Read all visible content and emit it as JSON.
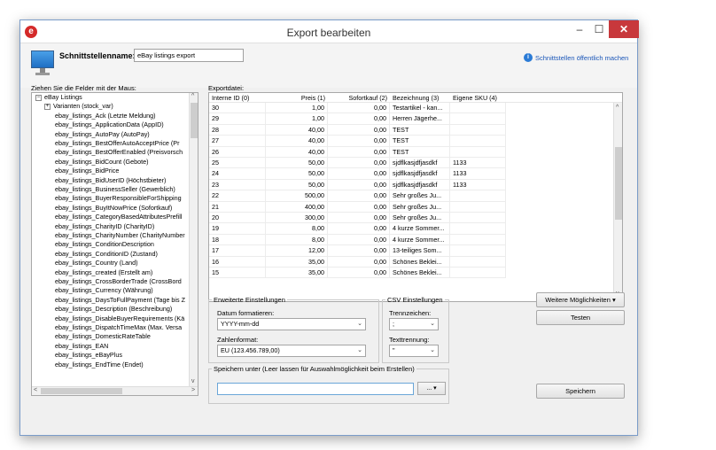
{
  "window": {
    "title": "Export bearbeiten",
    "minimize": "–",
    "maximize": "☐",
    "close": "✕",
    "app_icon": "e"
  },
  "header": {
    "interface_label": "Schnittstellenname:",
    "interface_value": "eBay listings export",
    "publish_link": "Schnittstellen öffentlich machen"
  },
  "tree": {
    "label": "Ziehen Sie die Felder mit der Maus:",
    "root": "eBay Listings",
    "root_toggle": "−",
    "items": [
      "Varianten (stock_var)",
      "ebay_listings_Ack (Letzte Meldung)",
      "ebay_listings_ApplicationData (AppID)",
      "ebay_listings_AutoPay (AutoPay)",
      "ebay_listings_BestOfferAutoAcceptPrice (Pr",
      "ebay_listings_BestOfferEnabled (Preisvorsch",
      "ebay_listings_BidCount (Gebote)",
      "ebay_listings_BidPrice",
      "ebay_listings_BidUserID (Höchstbieter)",
      "ebay_listings_BusinessSeller (Gewerblich)",
      "ebay_listings_BuyerResponsibleForShipping",
      "ebay_listings_BuyItNowPrice (Sofortkauf)",
      "ebay_listings_CategoryBasedAttributesPrefill",
      "ebay_listings_CharityID (CharityID)",
      "ebay_listings_CharityNumber (CharityNumber",
      "ebay_listings_ConditionDescription",
      "ebay_listings_ConditionID (Zustand)",
      "ebay_listings_Country (Land)",
      "ebay_listings_created (Erstellt am)",
      "ebay_listings_CrossBorderTrade (CrossBord",
      "ebay_listings_Currency (Währung)",
      "ebay_listings_DaysToFullPayment (Tage bis Z",
      "ebay_listings_Description (Beschreibung)",
      "ebay_listings_DisableBuyerRequirements (Kä",
      "ebay_listings_DispatchTimeMax (Max. Versa",
      "ebay_listings_DomesticRateTable",
      "ebay_listings_EAN",
      "ebay_listings_eBayPlus",
      "ebay_listings_EndTime (Endet)"
    ]
  },
  "grid": {
    "label": "Exportdatei:",
    "columns": [
      "Interne ID (0)",
      "Preis (1)",
      "Sofortkauf (2)",
      "Bezeichnung (3)",
      "Eigene SKU (4)"
    ],
    "rows": [
      [
        "30",
        "1,00",
        "0,00",
        "Testartikel - kan...",
        ""
      ],
      [
        "29",
        "1,00",
        "0,00",
        "Herren Jägerhe...",
        ""
      ],
      [
        "28",
        "40,00",
        "0,00",
        "TEST",
        ""
      ],
      [
        "27",
        "40,00",
        "0,00",
        "TEST",
        ""
      ],
      [
        "26",
        "40,00",
        "0,00",
        "TEST",
        ""
      ],
      [
        "25",
        "50,00",
        "0,00",
        "sjdflkasjdfjasdkf",
        "1133"
      ],
      [
        "24",
        "50,00",
        "0,00",
        "sjdflkasjdfjasdkf",
        "1133"
      ],
      [
        "23",
        "50,00",
        "0,00",
        "sjdflkasjdfjasdkf",
        "1133"
      ],
      [
        "22",
        "500,00",
        "0,00",
        "Sehr großes Ju...",
        ""
      ],
      [
        "21",
        "400,00",
        "0,00",
        "Sehr großes Ju...",
        ""
      ],
      [
        "20",
        "300,00",
        "0,00",
        "Sehr großes Ju...",
        ""
      ],
      [
        "19",
        "8,00",
        "0,00",
        "4 kurze Sommer...",
        ""
      ],
      [
        "18",
        "8,00",
        "0,00",
        "4 kurze Sommer...",
        ""
      ],
      [
        "17",
        "12,00",
        "0,00",
        "13-teiliges Som...",
        ""
      ],
      [
        "16",
        "35,00",
        "0,00",
        "Schönes Beklei...",
        ""
      ],
      [
        "15",
        "35,00",
        "0,00",
        "Schönes Beklei...",
        ""
      ]
    ]
  },
  "advanced": {
    "legend": "Erweiterte Einstellungen",
    "date_label": "Datum formatieren:",
    "date_value": "YYYY-mm-dd",
    "number_label": "Zahlenformat:",
    "number_value": "EU (123.456.789,00)"
  },
  "csv": {
    "legend": "CSV Einstellungen",
    "separator_label": "Trennzeichen:",
    "separator_value": ";",
    "text_sep_label": "Texttrennung:",
    "text_sep_value": "\""
  },
  "save": {
    "legend": "Speichern unter (Leer lassen für Auswahlmöglichkeit beim Erstellen)",
    "path_value": "",
    "browse_label": "..."
  },
  "buttons": {
    "more_options": "Weitere Möglichkeiten",
    "test": "Testen",
    "save": "Speichern"
  },
  "icons": {
    "app": "app-logo-icon",
    "monitor": "monitor-icon",
    "info": "info-icon"
  }
}
